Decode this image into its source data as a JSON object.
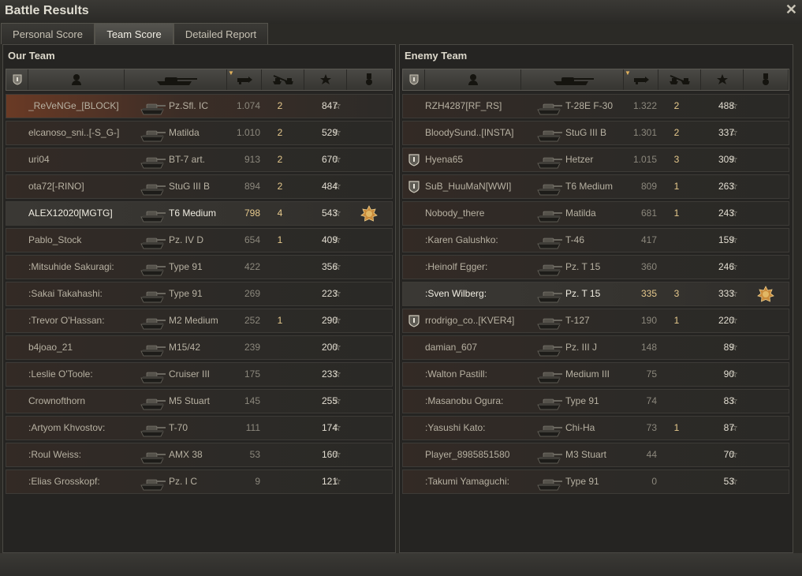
{
  "window": {
    "title": "Battle Results",
    "close_icon": "close-icon"
  },
  "tabs": [
    {
      "label": "Personal Score"
    },
    {
      "label": "Team Score",
      "active": true
    },
    {
      "label": "Detailed Report"
    }
  ],
  "columns": [
    "squad-icon",
    "player-icon",
    "vehicle-icon",
    "damage-icon",
    "kills-icon",
    "xp-star-icon",
    "medal-icon"
  ],
  "our_team": {
    "title": "Our Team",
    "rows": [
      {
        "name": "_ReVeNGe_[BLOCK]",
        "vehicle": "Pz.Sfl. IC",
        "damage": "1.074",
        "kills": "2",
        "xp": "847",
        "player": true
      },
      {
        "name": "elcanoso_sni..[-S_G-]",
        "vehicle": "Matilda",
        "damage": "1.010",
        "kills": "2",
        "xp": "529"
      },
      {
        "name": "uri04",
        "vehicle": "BT-7 art.",
        "damage": "913",
        "kills": "2",
        "xp": "670"
      },
      {
        "name": "ota72[-RINO]",
        "vehicle": "StuG III B",
        "damage": "894",
        "kills": "2",
        "xp": "484"
      },
      {
        "name": "ALEX12020[MGTG]",
        "vehicle": "T6 Medium",
        "damage": "798",
        "kills": "4",
        "xp": "543",
        "highlight": true,
        "medal": true
      },
      {
        "name": "Pablo_Stock",
        "vehicle": "Pz. IV D",
        "damage": "654",
        "kills": "1",
        "xp": "409"
      },
      {
        "name": ":Mitsuhide Sakuragi:",
        "vehicle": "Type 91",
        "damage": "422",
        "kills": "",
        "xp": "356"
      },
      {
        "name": ":Sakai Takahashi:",
        "vehicle": "Type 91",
        "damage": "269",
        "kills": "",
        "xp": "223"
      },
      {
        "name": ":Trevor O'Hassan:",
        "vehicle": "M2 Medium",
        "damage": "252",
        "kills": "1",
        "xp": "290"
      },
      {
        "name": "b4joao_21",
        "vehicle": "M15/42",
        "damage": "239",
        "kills": "",
        "xp": "200"
      },
      {
        "name": ":Leslie O'Toole:",
        "vehicle": "Cruiser III",
        "damage": "175",
        "kills": "",
        "xp": "233"
      },
      {
        "name": "Crownofthorn",
        "vehicle": "M5 Stuart",
        "damage": "145",
        "kills": "",
        "xp": "255"
      },
      {
        "name": ":Artyom Khvostov:",
        "vehicle": "T-70",
        "damage": "111",
        "kills": "",
        "xp": "174"
      },
      {
        "name": ":Roul Weiss:",
        "vehicle": "AMX 38",
        "damage": "53",
        "kills": "",
        "xp": "160"
      },
      {
        "name": ":Elias Grosskopf:",
        "vehicle": "Pz. I C",
        "damage": "9",
        "kills": "",
        "xp": "121"
      }
    ]
  },
  "enemy_team": {
    "title": "Enemy Team",
    "rows": [
      {
        "name": "RZH4287[RF_RS]",
        "vehicle": "T-28E F-30",
        "damage": "1.322",
        "kills": "2",
        "xp": "488"
      },
      {
        "name": "BloodySund..[INSTA]",
        "vehicle": "StuG III B",
        "damage": "1.301",
        "kills": "2",
        "xp": "337"
      },
      {
        "name": "Hyena65",
        "vehicle": "Hetzer",
        "damage": "1.015",
        "kills": "3",
        "xp": "309",
        "squad": true
      },
      {
        "name": "SuB_HuuMaN[WWI]",
        "vehicle": "T6 Medium",
        "damage": "809",
        "kills": "1",
        "xp": "263",
        "squad": true
      },
      {
        "name": "Nobody_there",
        "vehicle": "Matilda",
        "damage": "681",
        "kills": "1",
        "xp": "243"
      },
      {
        "name": ":Karen Galushko:",
        "vehicle": "T-46",
        "damage": "417",
        "kills": "",
        "xp": "159"
      },
      {
        "name": ":Heinolf Egger:",
        "vehicle": "Pz. T 15",
        "damage": "360",
        "kills": "",
        "xp": "246"
      },
      {
        "name": ":Sven Wilberg:",
        "vehicle": "Pz. T 15",
        "damage": "335",
        "kills": "3",
        "xp": "333",
        "highlight": true,
        "medal": true
      },
      {
        "name": "rrodrigo_co..[KVER4]",
        "vehicle": "T-127",
        "damage": "190",
        "kills": "1",
        "xp": "220",
        "squad": true
      },
      {
        "name": "damian_607",
        "vehicle": "Pz. III J",
        "damage": "148",
        "kills": "",
        "xp": "89"
      },
      {
        "name": ":Walton Pastill:",
        "vehicle": "Medium III",
        "damage": "75",
        "kills": "",
        "xp": "90"
      },
      {
        "name": ":Masanobu Ogura:",
        "vehicle": "Type 91",
        "damage": "74",
        "kills": "",
        "xp": "83"
      },
      {
        "name": ":Yasushi Kato:",
        "vehicle": "Chi-Ha",
        "damage": "73",
        "kills": "1",
        "xp": "87"
      },
      {
        "name": "Player_8985851580",
        "vehicle": "M3 Stuart",
        "damage": "44",
        "kills": "",
        "xp": "70"
      },
      {
        "name": ":Takumi Yamaguchi:",
        "vehicle": "Type 91",
        "damage": "0",
        "kills": "",
        "xp": "53"
      }
    ]
  }
}
